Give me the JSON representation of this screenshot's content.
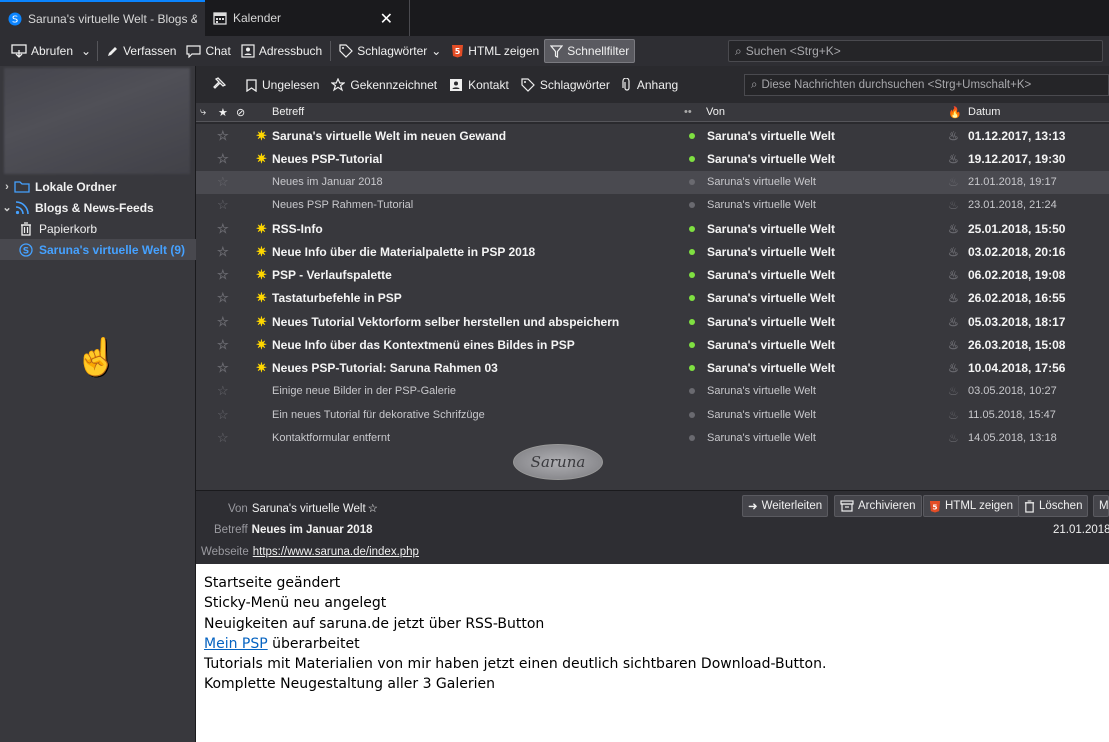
{
  "tabs": [
    {
      "label": "Saruna's virtuelle Welt - Blogs &",
      "icon": "saruna-feed-icon"
    },
    {
      "label": "Kalender",
      "icon": "calendar-icon"
    }
  ],
  "toolbar": {
    "get_label": "Abrufen",
    "write_label": "Verfassen",
    "chat_label": "Chat",
    "addressbook_label": "Adressbuch",
    "tags_label": "Schlagwörter",
    "html_label": "HTML zeigen",
    "quickfilter_label": "Schnellfilter",
    "search_placeholder": "Suchen <Strg+K>"
  },
  "sidebar": {
    "folders": [
      {
        "label": "Lokale Ordner",
        "icon": "folder-icon"
      },
      {
        "label": "Blogs & News-Feeds",
        "icon": "rss-icon"
      },
      {
        "label": "Papierkorb",
        "icon": "trash-icon"
      },
      {
        "label": "Saruna's virtuelle Welt (9)",
        "icon": "saruna-feed-icon"
      }
    ]
  },
  "quickfilter": {
    "unread": "Ungelesen",
    "starred": "Gekennzeichnet",
    "contact": "Kontakt",
    "tags": "Schlagwörter",
    "attachment": "Anhang",
    "search_placeholder": "Diese Nachrichten durchsuchen <Strg+Umschalt+K>"
  },
  "columns": {
    "subject": "Betreff",
    "from": "Von",
    "date": "Datum"
  },
  "colors": {
    "accent": "#0a84ff",
    "unread_dot": "#7fe041",
    "new_icon": "#ffd700",
    "link": "#0563c1"
  },
  "messages": [
    {
      "subject": "Saruna's virtuelle Welt im neuen Gewand",
      "from": "Saruna's virtuelle Welt",
      "date": "01.12.2017, 13:13",
      "unread": true
    },
    {
      "subject": "Neues PSP-Tutorial",
      "from": "Saruna's virtuelle Welt",
      "date": "19.12.2017, 19:30",
      "unread": true
    },
    {
      "subject": "Neues im Januar 2018",
      "from": "Saruna's virtuelle Welt",
      "date": "21.01.2018, 19:17",
      "unread": false
    },
    {
      "subject": "Neues PSP Rahmen-Tutorial",
      "from": "Saruna's virtuelle Welt",
      "date": "23.01.2018, 21:24",
      "unread": false
    },
    {
      "subject": "RSS-Info",
      "from": "Saruna's virtuelle Welt",
      "date": "25.01.2018, 15:50",
      "unread": true
    },
    {
      "subject": "Neue Info über die Materialpalette in PSP 2018",
      "from": "Saruna's virtuelle Welt",
      "date": "03.02.2018, 20:16",
      "unread": true
    },
    {
      "subject": "PSP - Verlaufspalette",
      "from": "Saruna's virtuelle Welt",
      "date": "06.02.2018, 19:08",
      "unread": true
    },
    {
      "subject": "Tastaturbefehle in PSP",
      "from": "Saruna's virtuelle Welt",
      "date": "26.02.2018, 16:55",
      "unread": true
    },
    {
      "subject": "Neues Tutorial Vektorform selber herstellen und abspeichern",
      "from": "Saruna's virtuelle Welt",
      "date": "05.03.2018, 18:17",
      "unread": true
    },
    {
      "subject": "Neue Info über das Kontextmenü eines Bildes in PSP",
      "from": "Saruna's virtuelle Welt",
      "date": "26.03.2018, 15:08",
      "unread": true
    },
    {
      "subject": "Neues PSP-Tutorial: Saruna Rahmen 03",
      "from": "Saruna's virtuelle Welt",
      "date": "10.04.2018, 17:56",
      "unread": true
    },
    {
      "subject": "Einige neue Bilder in der PSP-Galerie",
      "from": "Saruna's virtuelle Welt",
      "date": "03.05.2018, 10:27",
      "unread": false
    },
    {
      "subject": "Ein neues Tutorial für dekorative Schrifzüge",
      "from": "Saruna's virtuelle Welt",
      "date": "11.05.2018, 15:47",
      "unread": false
    },
    {
      "subject": "Kontaktformular entfernt",
      "from": "Saruna's virtuelle Welt",
      "date": "14.05.2018, 13:18",
      "unread": false
    }
  ],
  "logo_text": "Saruna",
  "message_header": {
    "from_label": "Von",
    "from_value": "Saruna's virtuelle Welt",
    "subject_label": "Betreff",
    "subject_value": "Neues im Januar 2018",
    "website_label": "Webseite",
    "website_value": "https://www.saruna.de/index.php",
    "date_value": "21.01.2018,",
    "forward_label": "Weiterleiten",
    "archive_label": "Archivieren",
    "html_label": "HTML zeigen",
    "delete_label": "Löschen",
    "more_label": "M"
  },
  "message_body": {
    "line1": "Startseite geändert",
    "line2": "Sticky-Menü neu angelegt",
    "line3": "Neuigkeiten auf saruna.de jetzt über RSS-Button",
    "line4_link": "Mein PSP",
    "line4_rest": " überarbeitet",
    "line5": "Tutorials mit Materialien von mir haben jetzt einen deutlich sichtbaren Download-Button.",
    "line6": "Komplette Neugestaltung aller 3 Galerien"
  }
}
